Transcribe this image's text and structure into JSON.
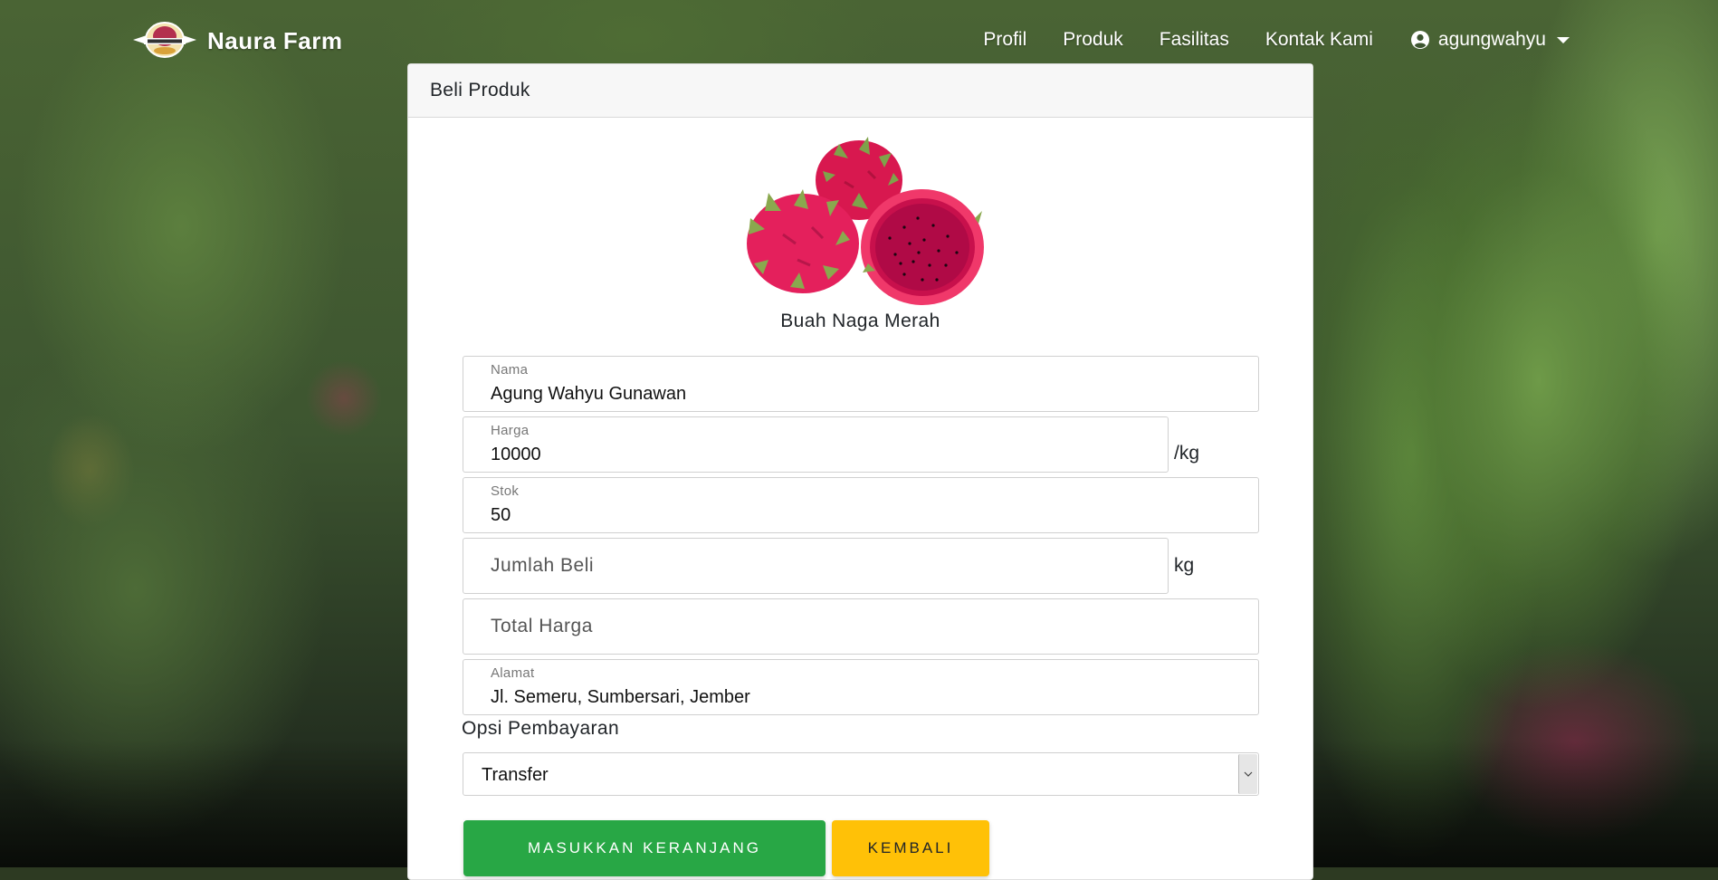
{
  "navbar": {
    "brand": "Naura Farm",
    "links": [
      "Profil",
      "Produk",
      "Fasilitas",
      "Kontak Kami"
    ],
    "user": "agungwahyu"
  },
  "card": {
    "header": "Beli Produk",
    "product_name": "Buah Naga Merah"
  },
  "form": {
    "nama_label": "Nama",
    "nama_value": "Agung Wahyu Gunawan",
    "harga_label": "Harga",
    "harga_value": "10000",
    "harga_unit": "/kg",
    "stok_label": "Stok",
    "stok_value": "50",
    "jumlah_placeholder": "Jumlah Beli",
    "jumlah_unit": "kg",
    "total_placeholder": "Total Harga",
    "alamat_label": "Alamat",
    "alamat_value": "Jl. Semeru, Sumbersari, Jember",
    "opsi_label": "Opsi Pembayaran",
    "opsi_value": "Transfer"
  },
  "buttons": {
    "cart": "MASUKKAN KERANJANG",
    "back": "KEMBALI"
  },
  "colors": {
    "primary_green": "#28a745",
    "warning_yellow": "#ffc107",
    "fruit_pink": "#e6195e"
  }
}
